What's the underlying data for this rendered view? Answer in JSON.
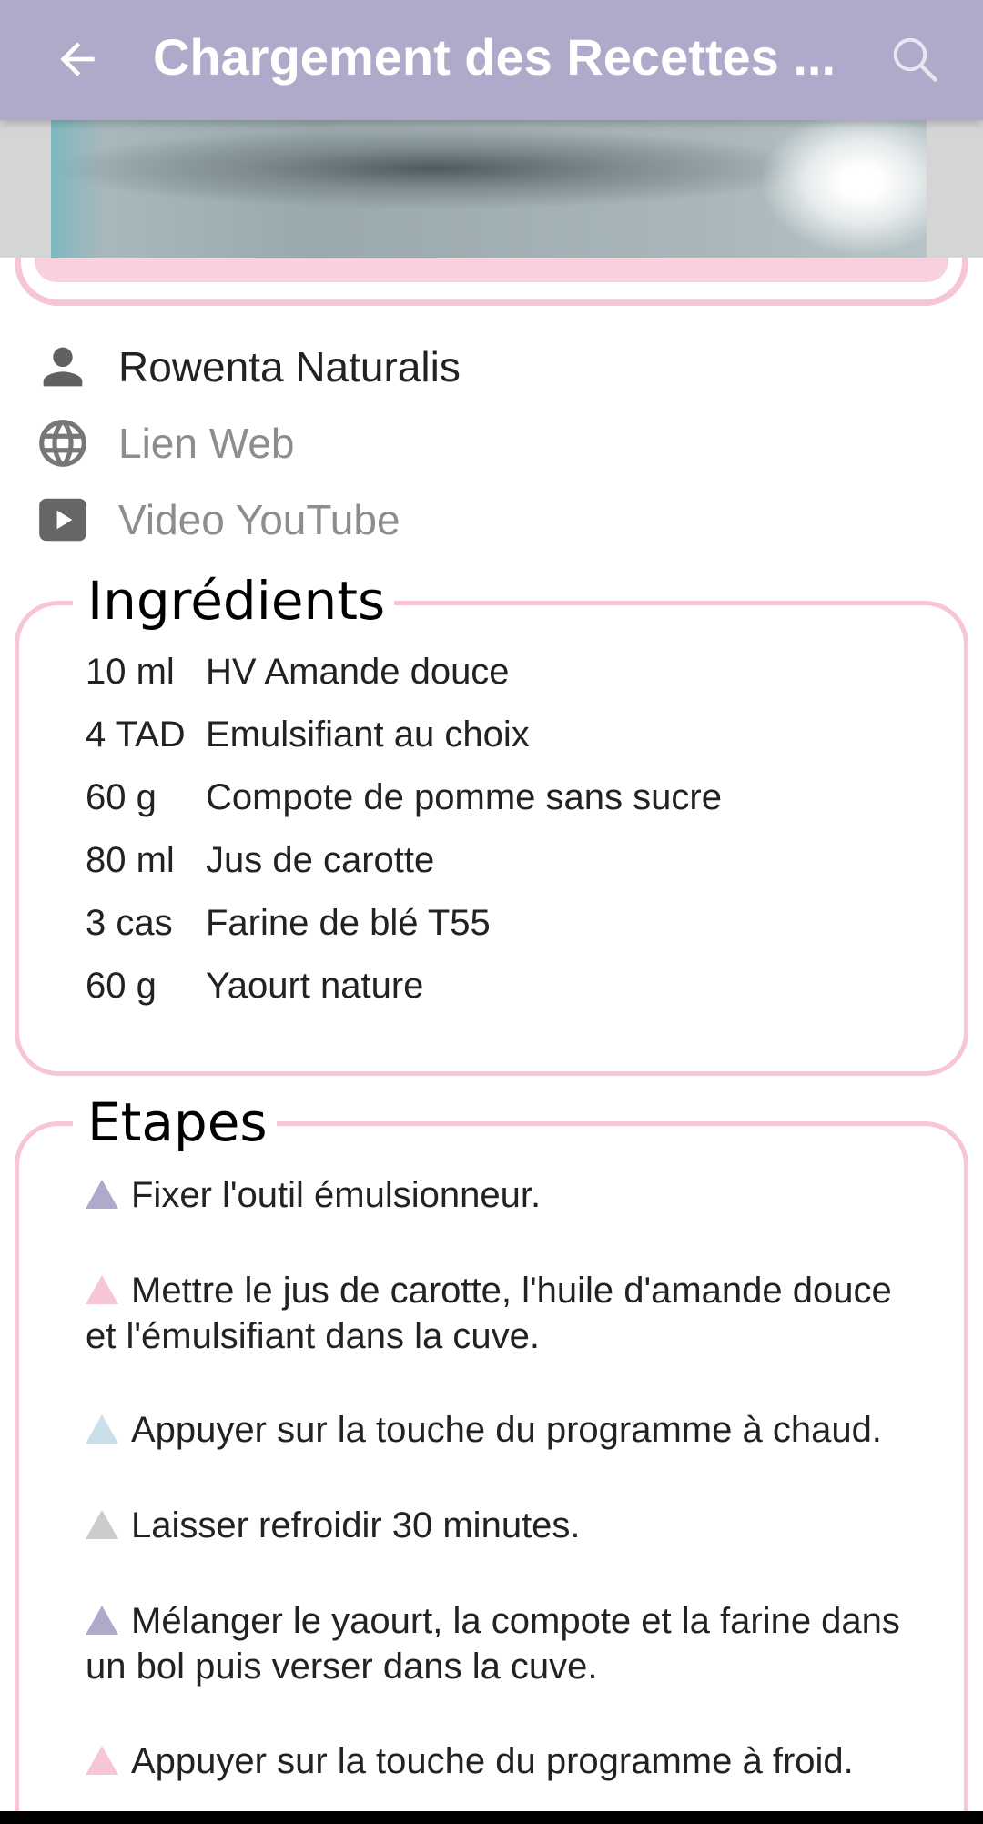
{
  "app_bar": {
    "title": "Chargement des Recettes ...",
    "back_icon": "arrow-left-icon",
    "search_icon": "search-icon",
    "background_color": "#b1a9c9"
  },
  "info": {
    "author": "Rowenta Naturalis",
    "web_link_label": "Lien Web",
    "video_label": "Video YouTube"
  },
  "ingredients": {
    "title": "Ingrédients",
    "items": [
      {
        "qty": "10 ml",
        "name": "HV Amande douce"
      },
      {
        "qty": "4 TAD",
        "name": "Emulsifiant au choix"
      },
      {
        "qty": "60 g",
        "name": "Compote de pomme sans sucre"
      },
      {
        "qty": "80 ml",
        "name": "Jus de carotte"
      },
      {
        "qty": "3 cas",
        "name": "Farine de blé T55"
      },
      {
        "qty": "60 g",
        "name": "Yaourt nature"
      }
    ]
  },
  "steps": {
    "title": "Etapes",
    "items": [
      {
        "text": "Fixer l'outil émulsionneur.",
        "color": "#b1a9c9"
      },
      {
        "text": "Mettre le jus de carotte, l'huile d'amande douce et l'émulsifiant dans la cuve.",
        "color": "#f7c6d6"
      },
      {
        "text": "Appuyer sur la touche du programme à chaud.",
        "color": "#c9e0ea"
      },
      {
        "text": "Laisser refroidir 30 minutes.",
        "color": "#cccccc"
      },
      {
        "text": "Mélanger le yaourt, la compote et la farine dans un bol puis verser dans la cuve.",
        "color": "#b1a9c9"
      },
      {
        "text": "Appuyer sur la touche du programme à froid.",
        "color": "#f7c6d6"
      }
    ]
  },
  "colors": {
    "accent_pink": "#f7c6d6",
    "accent_purple": "#b1a9c9"
  }
}
